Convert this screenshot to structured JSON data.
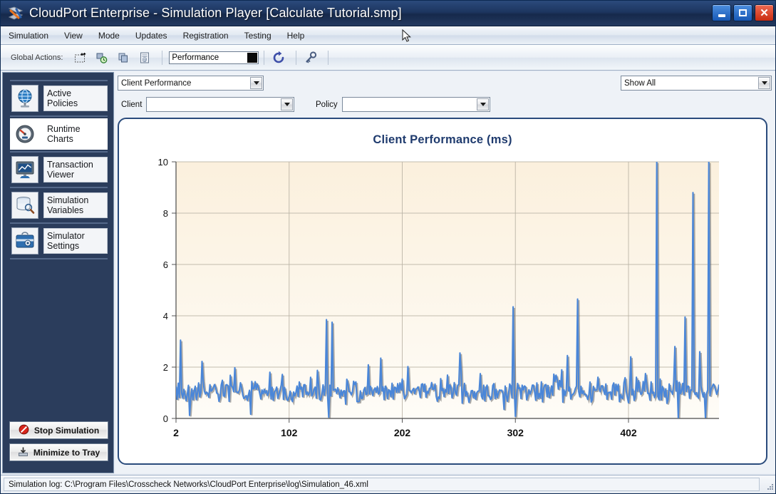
{
  "window": {
    "title": "CloudPort Enterprise - Simulation Player [Calculate Tutorial.smp]",
    "app_icon": "cloudport-logo-icon",
    "controls": {
      "minimize": "minimize-icon",
      "maximize": "maximize-icon",
      "close": "close-icon"
    }
  },
  "menubar": {
    "items": [
      {
        "label": "Simulation"
      },
      {
        "label": "View"
      },
      {
        "label": "Mode"
      },
      {
        "label": "Updates"
      },
      {
        "label": "Registration"
      },
      {
        "label": "Testing"
      },
      {
        "label": "Help"
      }
    ]
  },
  "toolbar": {
    "label": "Global Actions:",
    "icons": [
      {
        "name": "new-simulation-icon"
      },
      {
        "name": "timed-simulation-icon"
      },
      {
        "name": "copy-simulation-icon"
      },
      {
        "name": "email-report-icon"
      },
      {
        "name": "refresh-icon"
      },
      {
        "name": "key-settings-icon"
      }
    ],
    "performance_field": {
      "value": "Performance",
      "placeholder": "Performance"
    }
  },
  "sidebar": {
    "items": [
      {
        "label": "Active Policies",
        "icon": "globe-network-icon",
        "active": false
      },
      {
        "label": "Runtime Charts",
        "icon": "gauge-icon",
        "active": true
      },
      {
        "label": "Transaction Viewer",
        "icon": "monitor-chart-icon",
        "active": false
      },
      {
        "label": "Simulation Variables",
        "icon": "database-search-icon",
        "active": false
      },
      {
        "label": "Simulator Settings",
        "icon": "toolbox-gear-icon",
        "active": false
      }
    ],
    "buttons": [
      {
        "label": "Stop Simulation",
        "icon": "stop-sign-icon"
      },
      {
        "label": "Minimize to Tray",
        "icon": "tray-arrow-icon"
      }
    ]
  },
  "filters": {
    "chart_select": {
      "value": "Client Performance"
    },
    "scope_select": {
      "value": "Show All"
    },
    "client": {
      "label": "Client",
      "value": ""
    },
    "policy": {
      "label": "Policy",
      "value": ""
    }
  },
  "status": {
    "text": "Simulation log: C:\\Program Files\\Crosscheck Networks\\CloudPort Enterprise\\log\\Simulation_46.xml",
    "grip": "resize-grip-icon"
  },
  "colors": {
    "titlebar": "#1d3660",
    "sidebar": "#2b3d5c",
    "panel_border": "#2a4b7c",
    "chart_title": "#1f3b6e",
    "series_line": "#4a86d8",
    "plot_bg": "#fdf6e9",
    "grid": "#b9b2a4",
    "close_button": "#c92c11"
  },
  "chart_data": {
    "type": "line",
    "title": "Client Performance (ms)",
    "xlabel": "",
    "ylabel": "",
    "xlim": [
      2,
      482
    ],
    "ylim": [
      0,
      10
    ],
    "grid": true,
    "legend": false,
    "xticks": [
      2,
      102,
      202,
      302,
      402
    ],
    "yticks": [
      0,
      2,
      4,
      6,
      8,
      10
    ],
    "series": [
      {
        "name": "Client Performance",
        "color": "#4a86d8",
        "baseline_mean": 1.0,
        "noise_amplitude": 0.55,
        "clipped_at_ylim": true,
        "spikes": [
          {
            "x": 6,
            "y": 3.05
          },
          {
            "x": 135,
            "y": 3.85
          },
          {
            "x": 140,
            "y": 3.75
          },
          {
            "x": 183,
            "y": 2.35
          },
          {
            "x": 253,
            "y": 2.55
          },
          {
            "x": 300,
            "y": 4.35
          },
          {
            "x": 348,
            "y": 2.45
          },
          {
            "x": 357,
            "y": 4.65
          },
          {
            "x": 404,
            "y": 2.4
          },
          {
            "x": 427,
            "y": 10.0
          },
          {
            "x": 443,
            "y": 2.8
          },
          {
            "x": 452,
            "y": 3.95
          },
          {
            "x": 459,
            "y": 8.8
          },
          {
            "x": 465,
            "y": 2.6
          },
          {
            "x": 473,
            "y": 10.0
          }
        ],
        "dropouts": [
          {
            "x": 14,
            "y": 0.12
          },
          {
            "x": 137,
            "y": 0.05
          },
          {
            "x": 302,
            "y": 0.08
          },
          {
            "x": 446,
            "y": 0.03
          },
          {
            "x": 470,
            "y": 0.04
          }
        ]
      }
    ]
  }
}
